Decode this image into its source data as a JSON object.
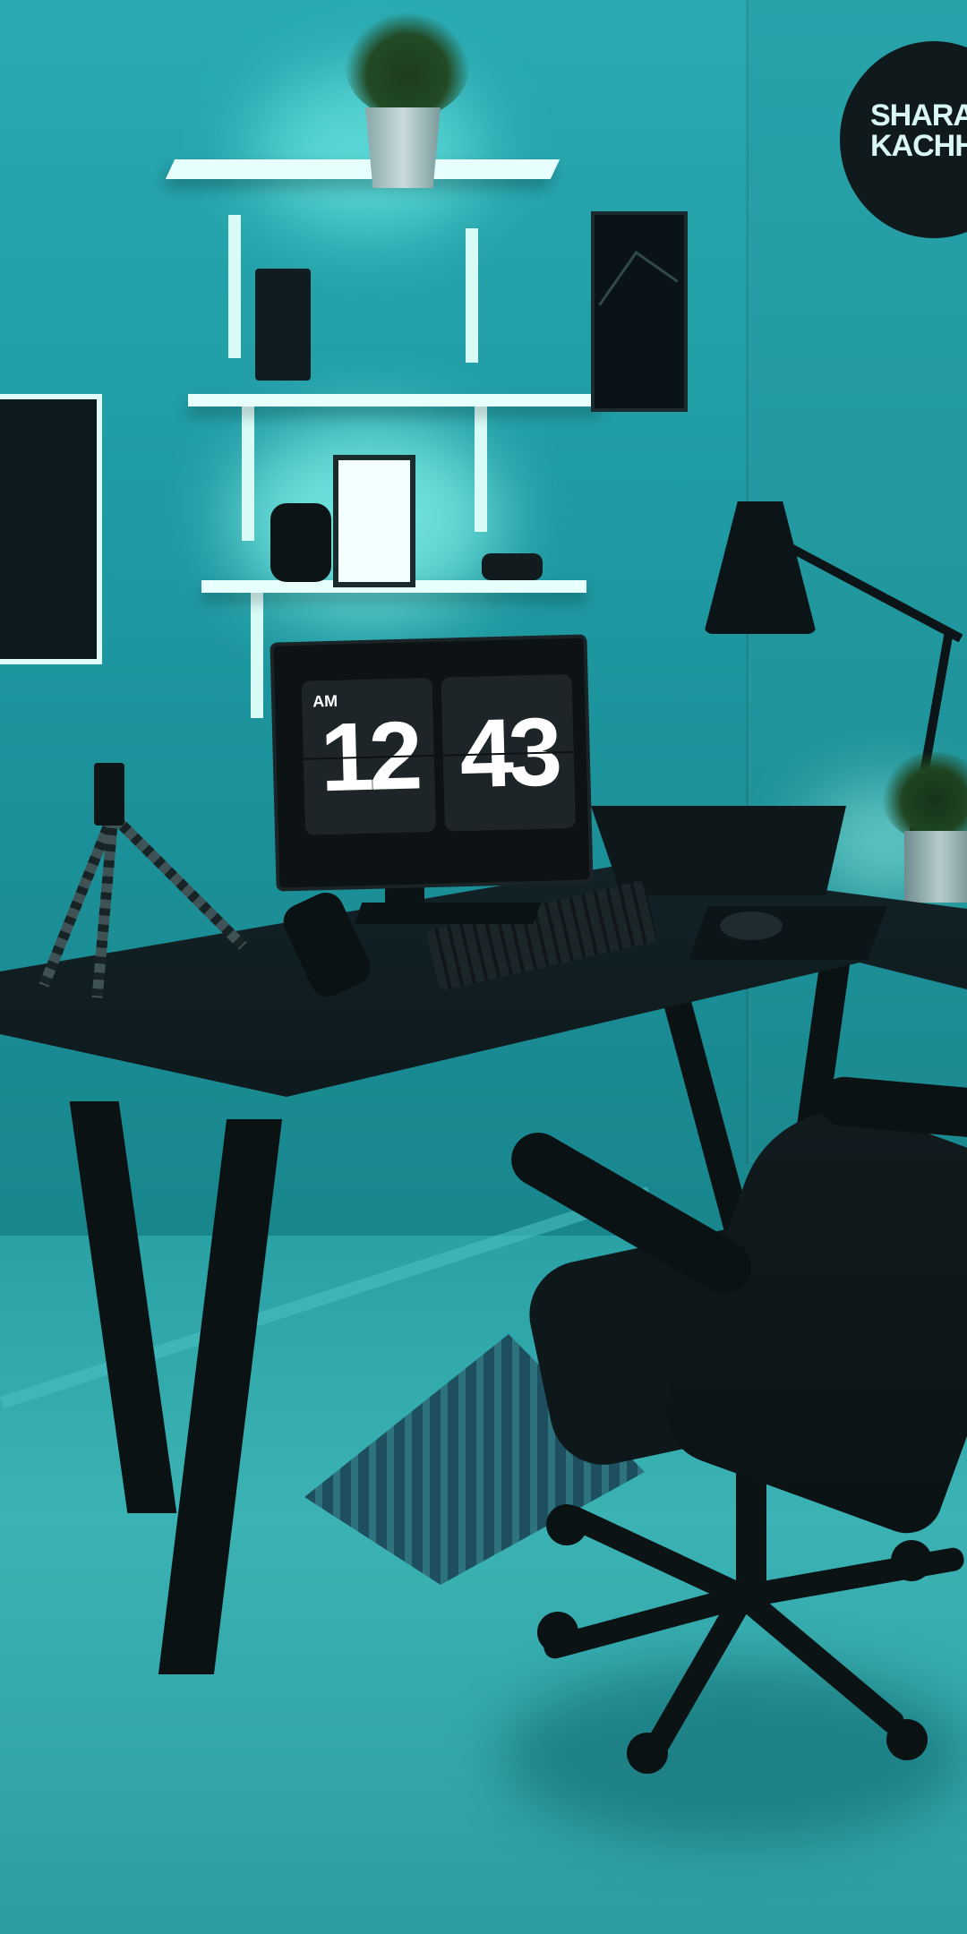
{
  "scene": {
    "description_free": true,
    "clock": {
      "ampm": "AM",
      "hours": "12",
      "minutes": "43"
    },
    "wall_logo": {
      "line1": "SHARAD",
      "line2": "KACHHI"
    },
    "colors": {
      "ambient_light": "#2aa9b1",
      "furniture": "#0b1416",
      "clock_text": "#ffffff"
    }
  }
}
